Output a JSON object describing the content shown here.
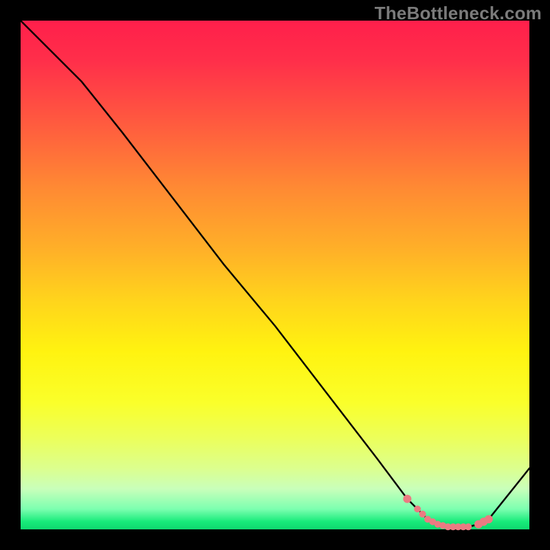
{
  "watermark": "TheBottleneck.com",
  "colors": {
    "frame_bg": "#000000",
    "curve_stroke": "#000000",
    "valley_dot": "#eb7b82",
    "gradient_top": "#ff1f4b",
    "gradient_bottom": "#0fd86f",
    "watermark_text": "#7b7b7b"
  },
  "chart_data": {
    "type": "line",
    "title": "",
    "xlabel": "",
    "ylabel": "",
    "xlim": [
      0,
      100
    ],
    "ylim": [
      0,
      100
    ],
    "x": [
      0,
      6,
      12,
      20,
      30,
      40,
      50,
      60,
      70,
      76,
      80,
      82,
      84,
      86,
      88,
      90,
      92,
      100
    ],
    "values": [
      100,
      94,
      88,
      78,
      65,
      52,
      40,
      27,
      14,
      6,
      2,
      1,
      0.5,
      0.5,
      0.5,
      1,
      2,
      12
    ],
    "valley_markers_x": [
      76,
      78,
      79,
      80,
      81,
      82,
      83,
      84,
      85,
      86,
      87,
      88,
      90,
      91,
      92
    ],
    "note": "x is horizontal fraction (0=left edge of plot, 100=right); values are normalized height (0=bottom green, 100=top red). No axes, ticks, or legend are rendered in the source image."
  }
}
